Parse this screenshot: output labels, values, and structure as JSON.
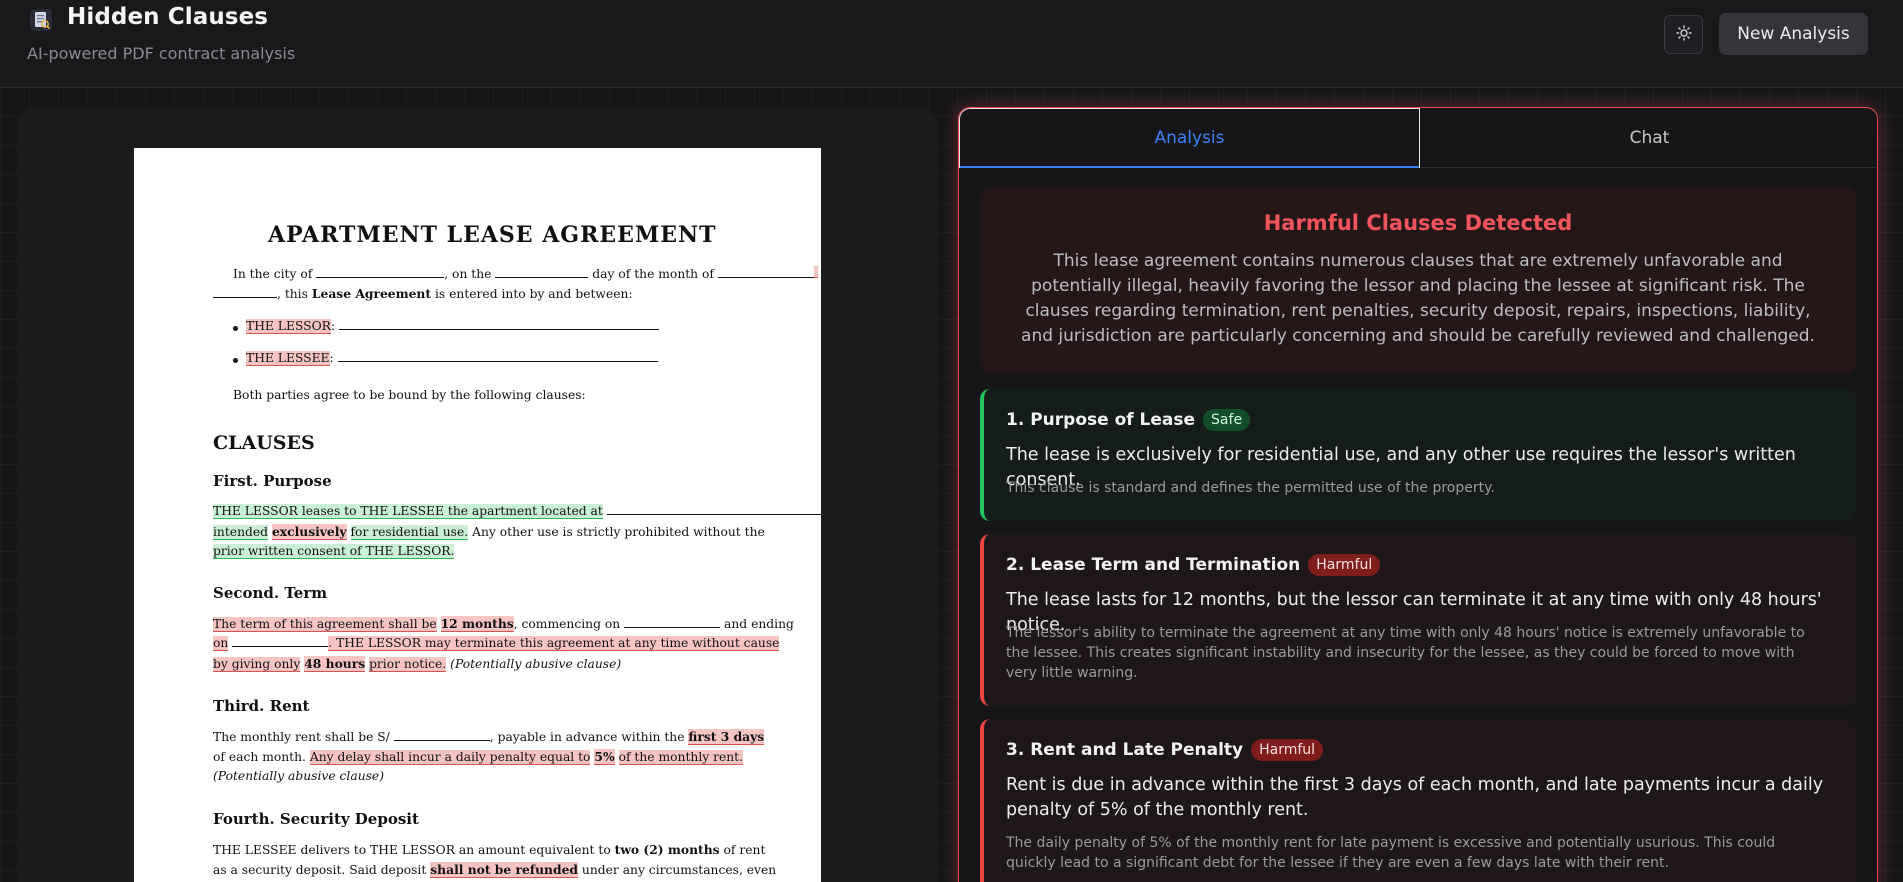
{
  "header": {
    "logo_icon": "document-icon",
    "title": "Hidden Clauses",
    "subtitle": "AI-powered PDF contract analysis",
    "theme_icon": "sun-icon",
    "new_analysis_label": "New Analysis"
  },
  "document": {
    "title": "APARTMENT LEASE AGREEMENT",
    "intro_1a": "In the city of",
    "intro_1b": ", on the",
    "intro_1c": "day of the month of",
    "intro_2a": ", this",
    "intro_2b": "Lease Agreement",
    "intro_2c": "is entered into by and between:",
    "lessor_label": "THE LESSOR",
    "lessee_label": "THE LESSEE",
    "parties_text": "Both parties agree to be bound by the following clauses:",
    "clauses_heading": "CLAUSES",
    "first_heading": "First.  Purpose",
    "first_l1": "THE LESSOR leases to THE LESSEE the apartment located at",
    "first_l2a": "intended",
    "first_l2b": "exclusively",
    "first_l2c": "for residential use.",
    "first_l2d": "Any other use is strictly prohibited without the",
    "first_l3": "prior written consent of THE LESSOR.",
    "second_heading": "Second.  Term",
    "second_l1a": "The term of this agreement shall be",
    "second_l1b": "12 months",
    "second_l1c": ", commencing on",
    "second_l1d": "and ending",
    "second_l2a": "on",
    "second_l2b": ".  THE LESSOR may terminate this agreement at any time without cause",
    "second_l3a": "by giving only",
    "second_l3b": "48 hours",
    "second_l3c": "prior notice.",
    "second_l3d": "(Potentially abusive clause)",
    "third_heading": "Third.  Rent",
    "third_l1a": "The monthly rent shall be S/",
    "third_l1b": ", payable in advance within the",
    "third_l1c": "first 3 days",
    "third_l2a": "of each month.",
    "third_l2b": "Any delay shall incur a daily penalty equal to",
    "third_l2c": "5%",
    "third_l2d": "of the monthly rent.",
    "third_l3": "(Potentially abusive clause)",
    "fourth_heading": "Fourth.  Security Deposit",
    "fourth_l1a": "THE LESSEE delivers to THE LESSOR an amount equivalent to",
    "fourth_l1b": "two (2) months",
    "fourth_l1c": "of rent",
    "fourth_l2a": "as a security deposit.  Said deposit",
    "fourth_l2b": "shall not be refunded",
    "fourth_l2c": "under any circumstances, even"
  },
  "tabs": {
    "analysis": "Analysis",
    "chat": "Chat"
  },
  "summary": {
    "title": "Harmful Clauses Detected",
    "text": "This lease agreement contains numerous clauses that are extremely unfavorable and potentially illegal, heavily favoring the lessor and placing the lessee at significant risk. The clauses regarding termination, rent penalties, security deposit, repairs, inspections, liability, and jurisdiction are particularly concerning and should be carefully reviewed and challenged."
  },
  "clauses": [
    {
      "title": "1. Purpose of Lease",
      "badge": "Safe",
      "summary": "The lease is exclusively for residential use, and any other use requires the lessor's written consent.",
      "explanation": "This clause is standard and defines the permitted use of the property."
    },
    {
      "title": "2. Lease Term and Termination",
      "badge": "Harmful",
      "summary": "The lease lasts for 12 months, but the lessor can terminate it at any time with only 48 hours' notice.",
      "explanation": "The lessor's ability to terminate the agreement at any time with only 48 hours' notice is extremely unfavorable to the lessee. This creates significant instability and insecurity for the lessee, as they could be forced to move with very little warning."
    },
    {
      "title": "3. Rent and Late Penalty",
      "badge": "Harmful",
      "summary": "Rent is due in advance within the first 3 days of each month, and late payments incur a daily penalty of 5% of the monthly rent.",
      "explanation": "The daily penalty of 5% of the monthly rent for late payment is excessive and potentially usurious. This could quickly lead to a significant debt for the lessee if they are even a few days late with their rent."
    }
  ],
  "colors": {
    "accent_blue": "#3b82f6",
    "harmful_red": "#ef4444",
    "safe_green": "#22c55e",
    "summary_title_red": "#f2545b"
  }
}
